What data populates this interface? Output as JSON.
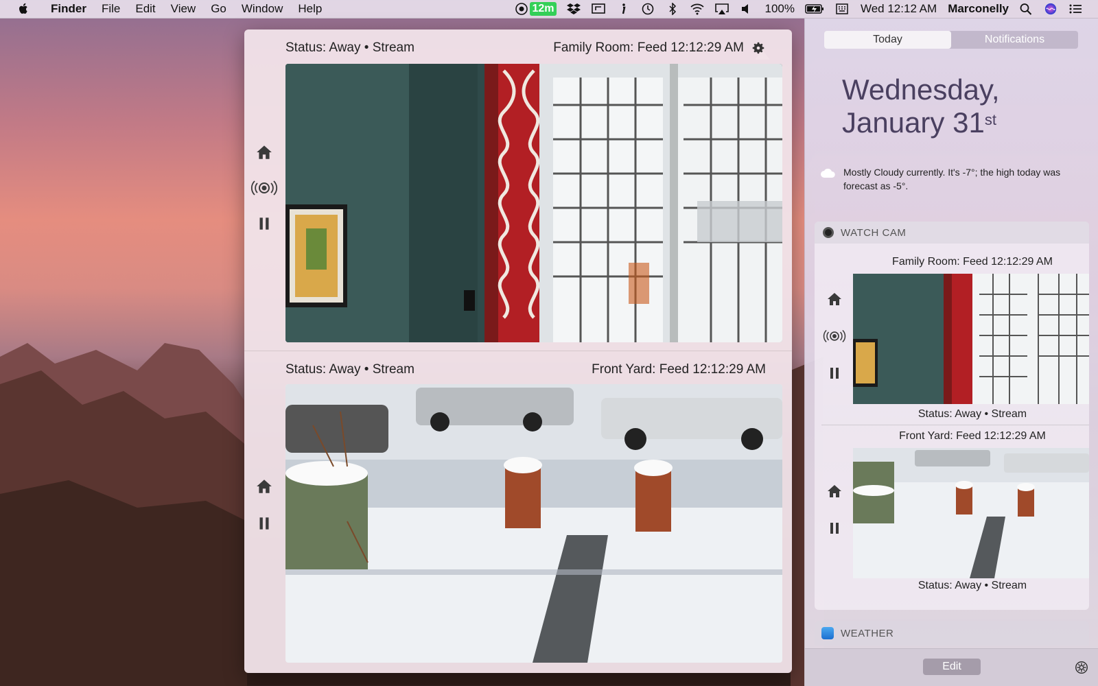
{
  "menubar": {
    "app_name": "Finder",
    "menus": [
      "File",
      "Edit",
      "View",
      "Go",
      "Window",
      "Help"
    ],
    "cam_badge": "12m",
    "battery": "100%",
    "clock": "Wed 12:12 AM",
    "user": "Marconelly"
  },
  "popover": {
    "cameras": [
      {
        "status": "Status: Away • Stream",
        "feed": "Family Room: Feed 12:12:29 AM"
      },
      {
        "status": "Status: Away • Stream",
        "feed": "Front Yard: Feed 12:12:29 AM"
      }
    ]
  },
  "notification_center": {
    "tabs": [
      "Today",
      "Notifications"
    ],
    "date_line1": "Wednesday,",
    "date_line2": "January 31",
    "date_suffix": "st",
    "weather_summary": "Mostly Cloudy currently. It's -7°; the high today was forecast as -5°.",
    "watch_cam": {
      "title": "WATCH CAM",
      "cameras": [
        {
          "feed": "Family Room: Feed 12:12:29 AM",
          "status": "Status: Away • Stream"
        },
        {
          "feed": "Front Yard: Feed 12:12:29 AM",
          "status": "Status: Away • Stream"
        }
      ]
    },
    "weather_widget_title": "WEATHER",
    "edit_label": "Edit"
  }
}
